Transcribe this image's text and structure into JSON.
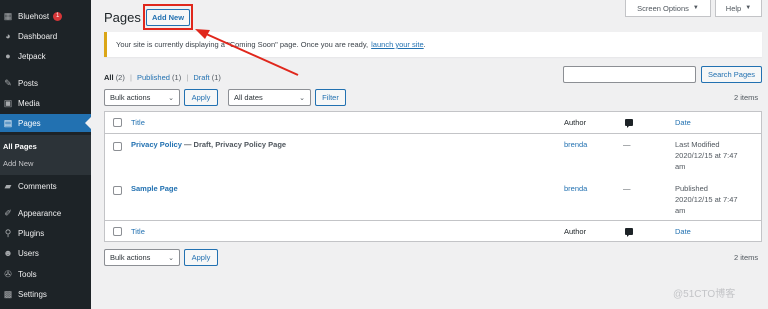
{
  "sidebar": {
    "items": [
      {
        "label": "Bluehost",
        "icon": "grid-icon",
        "badge": "1"
      },
      {
        "label": "Dashboard",
        "icon": "dashboard-icon"
      },
      {
        "label": "Jetpack",
        "icon": "jetpack-icon"
      },
      {
        "label": "Posts",
        "icon": "pin-icon"
      },
      {
        "label": "Media",
        "icon": "media-icon"
      },
      {
        "label": "Pages",
        "icon": "pages-icon",
        "current": true
      },
      {
        "label": "Comments",
        "icon": "comments-icon"
      },
      {
        "label": "Appearance",
        "icon": "appearance-icon"
      },
      {
        "label": "Plugins",
        "icon": "plugins-icon"
      },
      {
        "label": "Users",
        "icon": "users-icon"
      },
      {
        "label": "Tools",
        "icon": "tools-icon"
      },
      {
        "label": "Settings",
        "icon": "settings-icon"
      }
    ],
    "submenu": [
      {
        "label": "All Pages",
        "current": true
      },
      {
        "label": "Add New"
      }
    ]
  },
  "header": {
    "title": "Pages",
    "add_new_label": "Add New",
    "screen_options_label": "Screen Options",
    "help_label": "Help"
  },
  "notice": {
    "text": "Your site is currently displaying a \"Coming Soon\" page. Once you are ready,",
    "link": "launch your site",
    "suffix": "."
  },
  "views": {
    "all_label": "All",
    "all_count": "(2)",
    "published_label": "Published",
    "published_count": "(1)",
    "draft_label": "Draft",
    "draft_count": "(1)",
    "separator": "|"
  },
  "search": {
    "placeholder": "",
    "button_label": "Search Pages"
  },
  "filters": {
    "bulk_actions_label": "Bulk actions",
    "apply_label": "Apply",
    "dates_label": "All dates",
    "filter_label": "Filter",
    "items_count": "2 items"
  },
  "table": {
    "columns": {
      "title": "Title",
      "author": "Author",
      "date": "Date"
    },
    "rows": [
      {
        "title": "Privacy Policy",
        "state": "— Draft, Privacy Policy Page",
        "author": "brenda",
        "comments": "—",
        "date_status": "Last Modified",
        "date_line1": "2020/12/15 at 7:47",
        "date_line2": "am"
      },
      {
        "title": "Sample Page",
        "state": "",
        "author": "brenda",
        "comments": "—",
        "date_status": "Published",
        "date_line1": "2020/12/15 at 7:47",
        "date_line2": "am"
      }
    ]
  },
  "bottom": {
    "bulk_actions_label": "Bulk actions",
    "apply_label": "Apply",
    "items_count": "2 items"
  },
  "watermark": "@51CTO博客",
  "colors": {
    "sidebar_bg": "#1d2327",
    "accent": "#2271b1",
    "highlight_box": "#e0271c",
    "notice_border": "#dba617",
    "badge": "#d63638"
  }
}
